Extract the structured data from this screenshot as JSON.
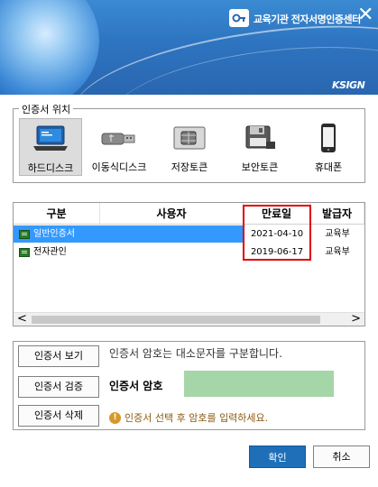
{
  "header": {
    "title": "교육기관 전자서명인증센터",
    "brand": "KSIGN",
    "close_symbol": "✕"
  },
  "location": {
    "legend": "인증서 위치",
    "items": [
      {
        "label": "하드디스크",
        "icon": "laptop-icon",
        "selected": true
      },
      {
        "label": "이동식디스크",
        "icon": "usb-drive-icon",
        "selected": false
      },
      {
        "label": "저장토큰",
        "icon": "chip-token-icon",
        "selected": false
      },
      {
        "label": "보안토큰",
        "icon": "security-token-icon",
        "selected": false
      },
      {
        "label": "휴대폰",
        "icon": "mobile-phone-icon",
        "selected": false
      }
    ]
  },
  "cert_table": {
    "columns": [
      "구분",
      "사용자",
      "만료일",
      "발급자"
    ],
    "rows": [
      {
        "type": "일반인증서",
        "user": "",
        "expiry": "2021-04-10",
        "issuer": "교육부",
        "selected": true
      },
      {
        "type": "전자관인",
        "user": "",
        "expiry": "2019-06-17",
        "issuer": "교육부",
        "selected": false
      }
    ],
    "scroll_left": "<",
    "scroll_right": ">"
  },
  "actions": {
    "view": "인증서 보기",
    "verify": "인증서 검증",
    "delete": "인증서 삭제"
  },
  "password": {
    "case_notice": "인증서 암호는 대소문자를 구분합니다.",
    "label": "인증서 암호",
    "value": "",
    "warning": "인증서 선택 후 암호를 입력하세요.",
    "warning_icon": "!"
  },
  "footer": {
    "ok": "확인",
    "cancel": "취소"
  },
  "colors": {
    "banner": "#2e74c0",
    "selected_row": "#3399ff",
    "password_field": "#a5d6a7",
    "ok_button": "#1e6fb8",
    "highlight_box": "#e00000",
    "warning": "#8a5a10"
  }
}
